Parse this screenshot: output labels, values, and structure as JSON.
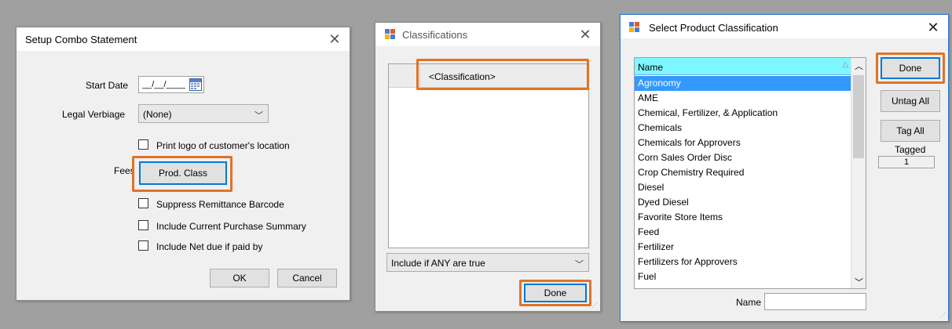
{
  "win1": {
    "title": "Setup Combo Statement",
    "start_date_label": "Start Date",
    "start_date_value": "__/__/____",
    "legal_label": "Legal Verbiage",
    "legal_value": "(None)",
    "print_logo_label": "Print logo of customer's location",
    "fees_label": "Fees",
    "prod_class_button": "Prod. Class",
    "suppress_label": "Suppress Remittance Barcode",
    "include_summary_label": "Include Current Purchase Summary",
    "include_net_label": "Include Net due if paid by",
    "ok": "OK",
    "cancel": "Cancel"
  },
  "win2": {
    "title": "Classifications",
    "column_header": "<Classification>",
    "combo_value": "Include if ANY are true",
    "done": "Done"
  },
  "win3": {
    "title": "Select Product Classification",
    "column_header": "Name",
    "items": [
      "Agronomy",
      "AME",
      "Chemical, Fertilizer, & Application",
      "Chemicals",
      "Chemicals for Approvers",
      "Corn Sales Order Disc",
      "Crop Chemistry Required",
      "Diesel",
      "Dyed Diesel",
      "Favorite Store Items",
      "Feed",
      "Fertilizer",
      "Fertilizers for Approvers",
      "Fuel"
    ],
    "selected_item": "Agronomy",
    "done": "Done",
    "untag_all": "Untag All",
    "tag_all": "Tag All",
    "tagged_label": "Tagged",
    "tagged_count": "1",
    "name_label": "Name",
    "name_value": ""
  },
  "colors": {
    "highlight_orange": "#e07326",
    "accent_blue": "#0078d7",
    "list_header_cyan": "#7ff7ff",
    "selection_blue": "#3399ff"
  }
}
